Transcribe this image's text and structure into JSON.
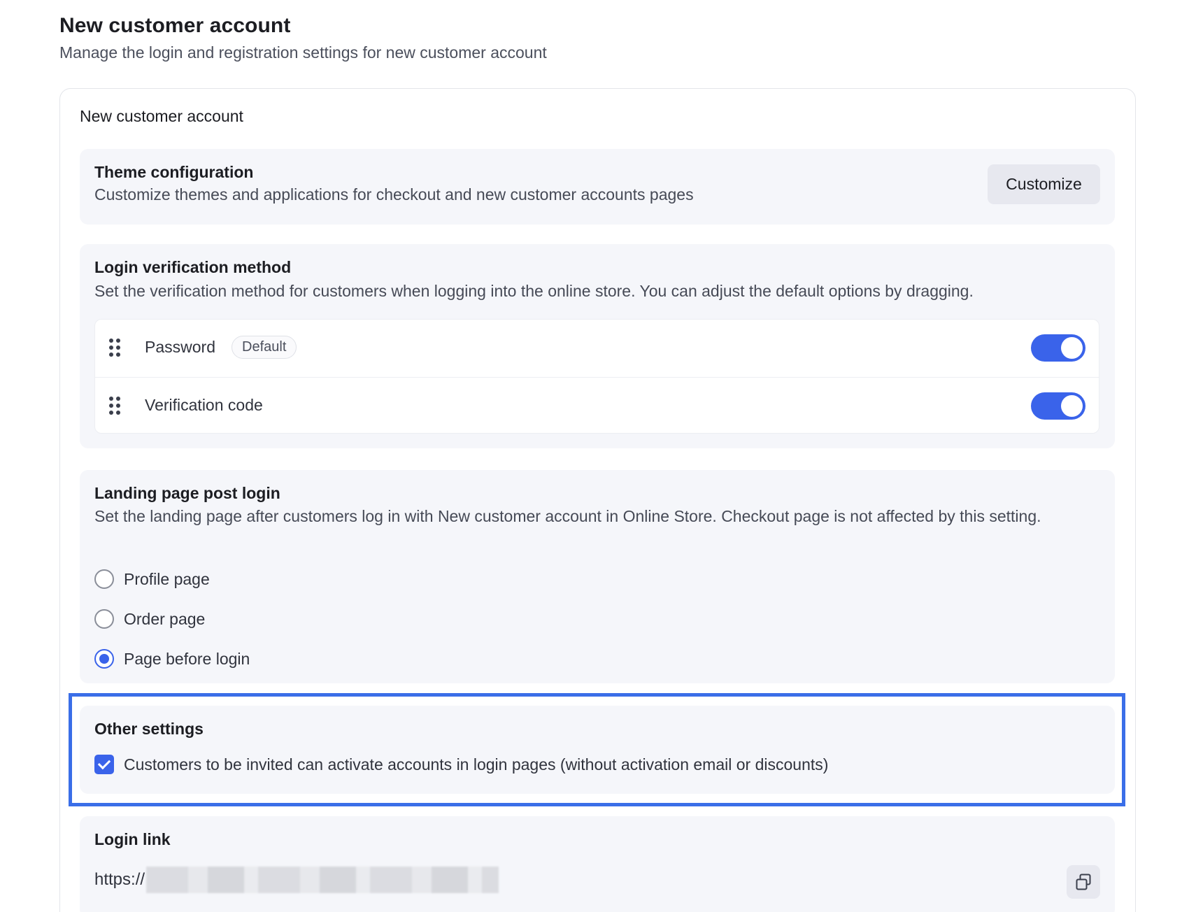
{
  "page": {
    "title": "New customer account",
    "subtitle": "Manage the login and registration settings for new customer account"
  },
  "card": {
    "title": "New customer account"
  },
  "theme": {
    "heading": "Theme configuration",
    "description": "Customize themes and applications for checkout and new customer accounts pages",
    "button_label": "Customize"
  },
  "login_verification": {
    "heading": "Login verification method",
    "description": "Set the verification method for customers when logging into the online store. You can adjust the default options by dragging.",
    "methods": [
      {
        "label": "Password",
        "badge": "Default",
        "enabled": true
      },
      {
        "label": "Verification code",
        "enabled": true
      }
    ]
  },
  "landing_page": {
    "heading": "Landing page post login",
    "description": "Set the landing page after customers log in with New customer account in Online Store. Checkout page is not affected by this setting.",
    "options": [
      {
        "label": "Profile page",
        "selected": false
      },
      {
        "label": "Order page",
        "selected": false
      },
      {
        "label": "Page before login",
        "selected": true
      }
    ]
  },
  "other_settings": {
    "heading": "Other settings",
    "checkbox_label": "Customers to be invited can activate accounts in login pages (without activation email or discounts)",
    "checked": true
  },
  "login_link": {
    "heading": "Login link",
    "url_prefix": "https://"
  },
  "colors": {
    "accent": "#3a63ea",
    "highlight_border": "#3a6ee8",
    "section_bg": "#f5f6fa"
  },
  "icons": {
    "drag": "drag-handle-icon",
    "copy": "copy-icon"
  }
}
